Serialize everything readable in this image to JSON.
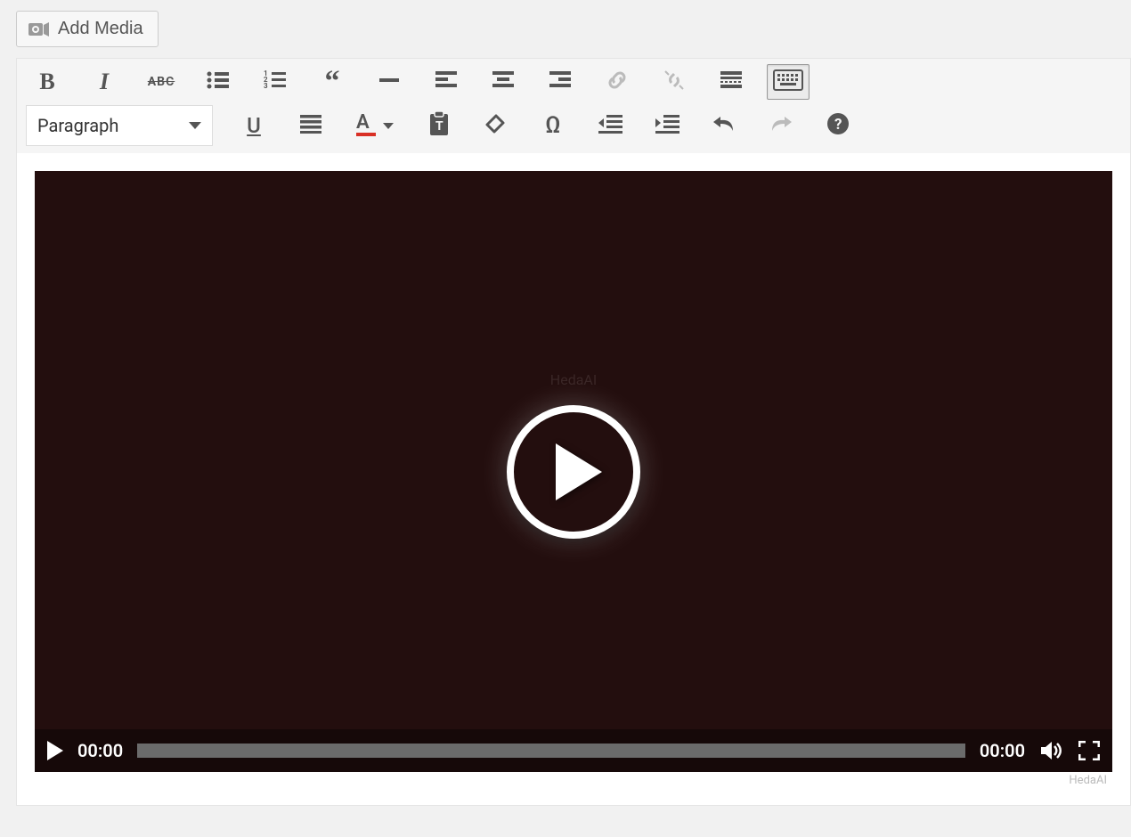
{
  "media_bar": {
    "add_media_label": "Add Media"
  },
  "toolbar_row1": {
    "bold": "B",
    "italic": "I",
    "strike": "ABC",
    "ul": "bulleted-list",
    "ol": "numbered-list",
    "quote": "blockquote",
    "hr": "horizontal-rule",
    "align_left": "align-left",
    "align_center": "align-center",
    "align_right": "align-right",
    "link": "link",
    "unlink": "unlink",
    "readmore": "read-more",
    "toolbar_toggle": "toolbar-toggle"
  },
  "toolbar_row2": {
    "format_label": "Paragraph",
    "underline": "U",
    "justify": "align-justify",
    "textcolor": "A",
    "paste_text": "paste-as-text",
    "clear_format": "clear-formatting",
    "special_char": "Ω",
    "outdent": "outdent",
    "indent": "indent",
    "undo": "undo",
    "redo": "redo",
    "help": "?"
  },
  "video": {
    "overlay_text": "HedaAI",
    "current_time": "00:00",
    "duration": "00:00"
  },
  "footer": {
    "watermark": "HedaAI"
  }
}
